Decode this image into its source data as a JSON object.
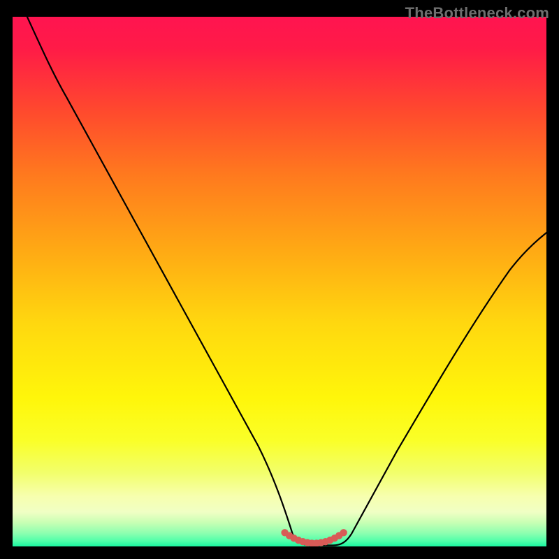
{
  "watermark": "TheBottleneck.com",
  "chart_data": {
    "type": "line",
    "title": "",
    "xlabel": "",
    "ylabel": "",
    "xlim": [
      0,
      100
    ],
    "ylim": [
      0,
      100
    ],
    "legend": null,
    "series": [
      {
        "name": "curve",
        "x": [
          0,
          5,
          10,
          15,
          20,
          25,
          30,
          35,
          40,
          45,
          50,
          55,
          60,
          65,
          70,
          75,
          80,
          85,
          90,
          95,
          100
        ],
        "y": [
          100,
          95,
          86,
          77,
          68,
          59,
          50,
          41,
          32,
          23,
          14,
          5,
          0,
          0,
          5,
          14,
          23,
          32,
          41,
          50,
          59
        ]
      }
    ],
    "annotations": [
      {
        "name": "bottleneck-marker",
        "x_start": 51,
        "x_end": 62,
        "y": 1
      }
    ],
    "background": {
      "type": "linear-gradient",
      "direction": "vertical",
      "stops": [
        {
          "pos": 0.0,
          "color": "#ff1450"
        },
        {
          "pos": 0.06,
          "color": "#ff1b47"
        },
        {
          "pos": 0.18,
          "color": "#ff4a2d"
        },
        {
          "pos": 0.3,
          "color": "#ff7a1e"
        },
        {
          "pos": 0.44,
          "color": "#ffa914"
        },
        {
          "pos": 0.58,
          "color": "#ffd80f"
        },
        {
          "pos": 0.72,
          "color": "#fff60a"
        },
        {
          "pos": 0.8,
          "color": "#faff28"
        },
        {
          "pos": 0.86,
          "color": "#f2ff6a"
        },
        {
          "pos": 0.905,
          "color": "#f7ffae"
        },
        {
          "pos": 0.935,
          "color": "#f0ffc4"
        },
        {
          "pos": 0.955,
          "color": "#c8ffb4"
        },
        {
          "pos": 0.975,
          "color": "#8dffb0"
        },
        {
          "pos": 0.99,
          "color": "#4fffaa"
        },
        {
          "pos": 1.0,
          "color": "#19f5a0"
        }
      ]
    }
  }
}
